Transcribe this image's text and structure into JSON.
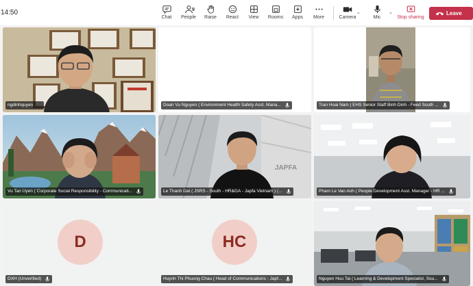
{
  "status": {
    "time": "14:50"
  },
  "toolbar": {
    "chat": "Chat",
    "people": "People",
    "people_count": "9",
    "raise": "Raise",
    "react": "React",
    "view": "View",
    "rooms": "Rooms",
    "apps": "Apps",
    "more": "More",
    "camera": "Camera",
    "mic": "Mic",
    "share": "Stop sharing",
    "leave": "Leave",
    "leave_color": "#c4314b"
  },
  "participants": [
    {
      "name": "ngdinhquyen"
    },
    {
      "name": "Doan Vu Nguyen ( Environment Health Safety Asst. Mana..."
    },
    {
      "name": "Tran Hoai Nam | EHS Senior Staff Binh Dinh - Feed South ..."
    },
    {
      "name": "Vu Tan Uyen ( Corporate Social Responsibility - Communicati..."
    },
    {
      "name": "Le Thanh Dat ( JSRS - South - HR&GA - Japfa Vietnam ) (..."
    },
    {
      "name": "Pham Le Van Anh ( People Development Asst. Manager - HR ..."
    },
    {
      "name": "DXH (Unverified)",
      "initials": "D"
    },
    {
      "name": "Huynh Thi Phuong Chau ( Head of Communications - Japf...",
      "initials": "HC"
    },
    {
      "name": "Nguyen Huu Tai ( Learning & Development Specialist, Sou..."
    }
  ],
  "background_text": "JAPFA"
}
